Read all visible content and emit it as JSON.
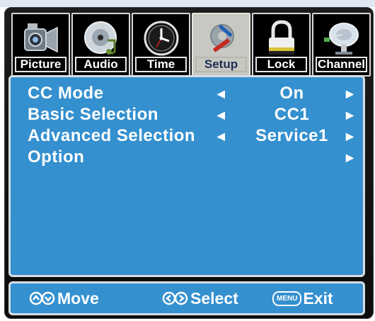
{
  "tabs": [
    {
      "label": "Picture",
      "icon": "camcorder-icon",
      "selected": false
    },
    {
      "label": "Audio",
      "icon": "speaker-cd-icon",
      "selected": false
    },
    {
      "label": "Time",
      "icon": "clock-icon",
      "selected": false
    },
    {
      "label": "Setup",
      "icon": "tools-gear-icon",
      "selected": true
    },
    {
      "label": "Lock",
      "icon": "padlock-icon",
      "selected": false
    },
    {
      "label": "Channel",
      "icon": "satellite-dish-icon",
      "selected": false
    }
  ],
  "menu": {
    "items": [
      {
        "label": "CC Mode",
        "value": "On"
      },
      {
        "label": "Basic Selection",
        "value": "CC1"
      },
      {
        "label": "Advanced Selection",
        "value": "Service1"
      },
      {
        "label": "Option",
        "value": ""
      }
    ]
  },
  "footer": {
    "move": "Move",
    "select": "Select",
    "menu_key": "MENU",
    "exit": "Exit"
  },
  "colors": {
    "panel": "#3490cf",
    "frame": "#141414",
    "selected_tab": "#c8c8c2"
  }
}
